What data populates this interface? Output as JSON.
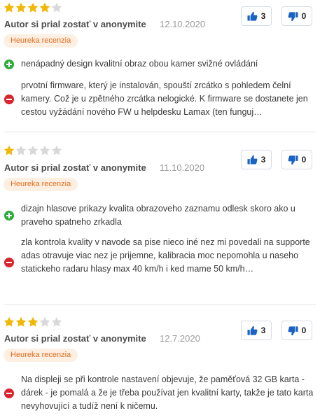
{
  "colors": {
    "star_filled": "#f2b705",
    "star_empty": "#d9d9d9",
    "pro": "#2eaa3c",
    "con": "#d8262e",
    "badge_text": "#e36c1c",
    "badge_bg": "#fdefe2",
    "vote_icon": "#1a63c4"
  },
  "icons": {
    "like": "thumbs-up-icon",
    "dislike": "thumbs-down-icon",
    "pro": "plus-circle-icon",
    "con": "minus-circle-icon"
  },
  "reviews": [
    {
      "rating": 4,
      "author": "Autor si prial zostať v anonymite",
      "date": "12.10.2020",
      "badge": "Heureka recenzia",
      "likes": "3",
      "dislikes": "0",
      "pros": "nenápadný design kvalitní obraz obou kamer svižné ovládání",
      "cons": "prvotní firmware, který je instalován, spouští zrcátko s pohledem čelní kamery. Což je u zpětného zrcátka nelogické. K firmware se dostanete jen cestou vyžádání nového FW u helpdesku Lamax (ten funguj…"
    },
    {
      "rating": 1,
      "author": "Autor si prial zostať v anonymite",
      "date": "11.10.2020",
      "badge": "Heureka recenzia",
      "likes": "3",
      "dislikes": "0",
      "pros": "dizajn hlasove prikazy kvalita obrazoveho zaznamu odlesk skoro ako u praveho spatneho zrkadla",
      "cons": "zla kontrola kvality v navode sa pise nieco iné nez mi povedali na supporte adas otravuje viac nez je prijemne, kalibracia moc nepomohla u naseho statickeho radaru hlasy max 40 km/h i ked mame 50 km/h…"
    },
    {
      "rating": 3,
      "author": "Autor si prial zostať v anonymite",
      "date": "12.7.2020",
      "badge": "Heureka recenzia",
      "likes": "3",
      "dislikes": "0",
      "cons": "Na displeji se při kontrole nastavení objevuje, že paměťová 32 GB karta - dárek - je pomalá a že je třeba používat jen kvalitní karty, takže je tato karta nevyhovující a tudíž není k ničemu."
    }
  ]
}
